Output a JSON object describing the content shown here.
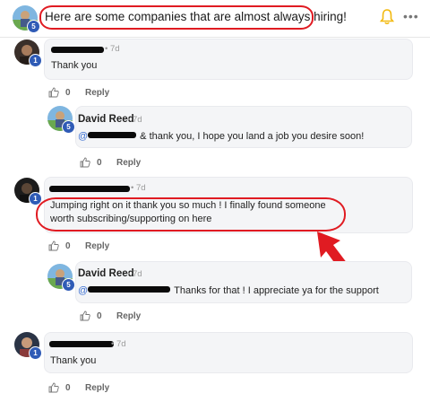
{
  "post": {
    "title": "Here are some companies that are almost always hiring!",
    "avatar_level": "5",
    "icons": [
      "bell-icon",
      "more-icon"
    ]
  },
  "comments": [
    {
      "author": "",
      "time": "• 7d",
      "body": "Thank you",
      "level": "1",
      "likes": "0",
      "reply_label": "Reply"
    },
    {
      "author": "David Reed",
      "time": "• 7d",
      "mention_prefix": "@",
      "body": "& thank you, I hope you land a job you desire soon!",
      "level": "5",
      "likes": "0",
      "reply_label": "Reply"
    },
    {
      "author": "",
      "time": "• 7d",
      "body": "Jumping right on it thank you so much ! I finally found someone worth subscribing/supporting on here",
      "level": "1",
      "likes": "0",
      "reply_label": "Reply"
    },
    {
      "author": "David Reed",
      "time": "• 7d",
      "mention_prefix": "@",
      "body": "Thanks for that ! I appreciate ya for the support",
      "level": "5",
      "likes": "0",
      "reply_label": "Reply"
    },
    {
      "author": "",
      "time": "• 7d",
      "body": "Thank you",
      "level": "1",
      "likes": "0",
      "reply_label": "Reply"
    }
  ],
  "colors": {
    "annotation_red": "#e01b22",
    "mention_blue": "#3b6fd1",
    "level_badge": "#2f5bb6",
    "bell_gold": "#f2b90f"
  }
}
